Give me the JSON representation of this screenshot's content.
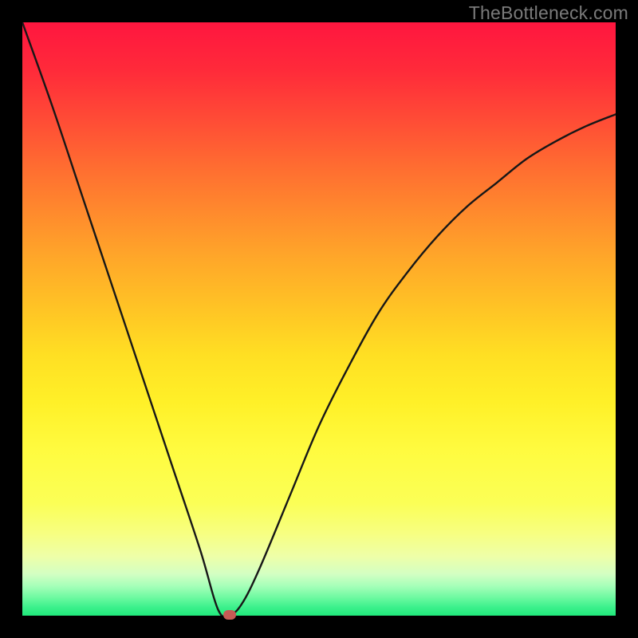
{
  "attribution": "TheBottleneck.com",
  "colors": {
    "frame": "#000000",
    "curve": "#171717",
    "marker": "#c85a55",
    "gradient_top": "#ff163f",
    "gradient_bottom": "#20e97b"
  },
  "chart_data": {
    "type": "line",
    "title": "",
    "xlabel": "",
    "ylabel": "",
    "xlim": [
      0,
      100
    ],
    "ylim": [
      0,
      100
    ],
    "x": [
      0,
      5,
      10,
      15,
      20,
      25,
      30,
      33,
      35,
      37,
      40,
      45,
      50,
      55,
      60,
      65,
      70,
      75,
      80,
      85,
      90,
      95,
      100
    ],
    "values": [
      100,
      86,
      71,
      56,
      41,
      26,
      11,
      1,
      0.2,
      2,
      8,
      20,
      32,
      42,
      51,
      58,
      64,
      69,
      73,
      77,
      80,
      82.5,
      84.5
    ],
    "marker": {
      "x": 35,
      "y": 0.2
    },
    "annotations": [],
    "legend": false,
    "grid": false
  }
}
